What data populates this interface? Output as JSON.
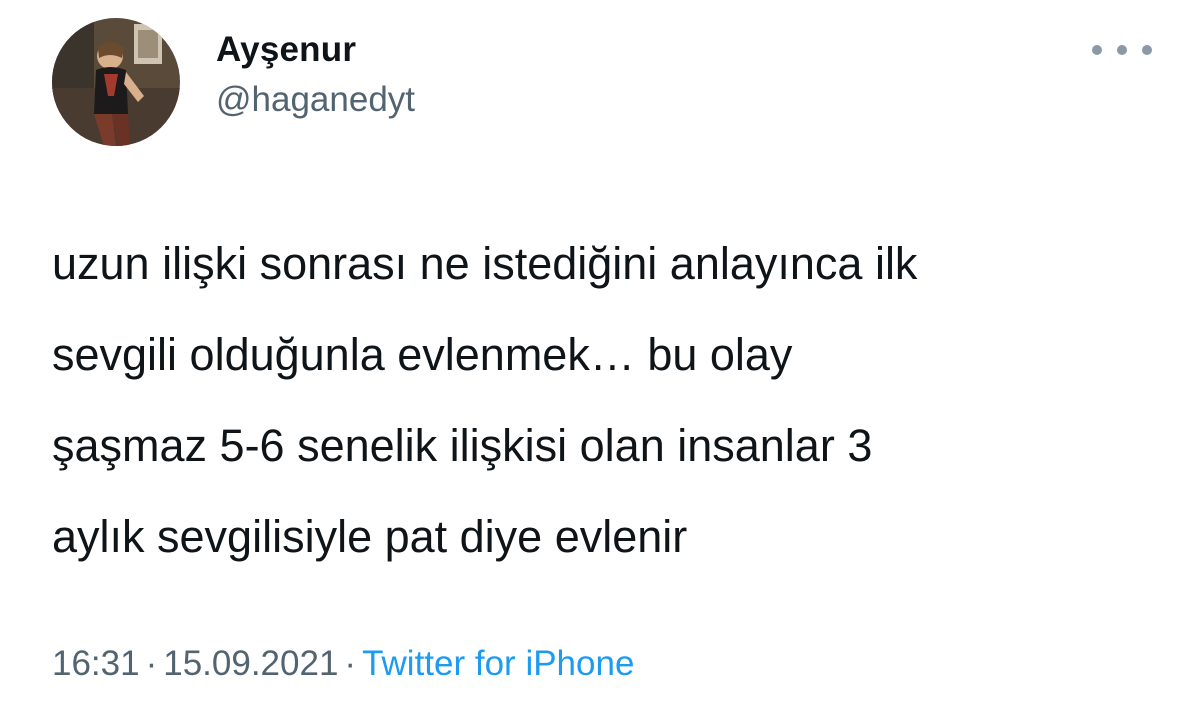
{
  "author": {
    "display_name": "Ayşenur",
    "handle": "@haganedyt"
  },
  "icons": {
    "avatar": "profile-photo",
    "more": "more-horizontal-icon"
  },
  "tweet": {
    "lines": [
      "uzun ilişki sonrası ne istediğini anlayınca ilk",
      "sevgili olduğunla evlenmek… bu olay",
      "şaşmaz 5-6 senelik ilişkisi olan insanlar 3",
      "aylık sevgilisiyle pat diye evlenir"
    ]
  },
  "meta": {
    "time": "16:31",
    "separator": "·",
    "date": "15.09.2021",
    "source": "Twitter for iPhone"
  },
  "colors": {
    "text": "#0f1419",
    "secondary": "#536471",
    "link": "#1d9bf0"
  }
}
